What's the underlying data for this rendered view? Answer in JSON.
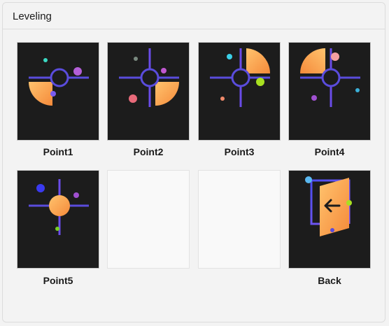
{
  "window": {
    "title": "Leveling"
  },
  "tiles": [
    {
      "label": "Point1",
      "icon": "bed-point-front-left-icon"
    },
    {
      "label": "Point2",
      "icon": "bed-point-front-right-icon"
    },
    {
      "label": "Point3",
      "icon": "bed-point-back-right-icon"
    },
    {
      "label": "Point4",
      "icon": "bed-point-back-left-icon"
    },
    {
      "label": "Point5",
      "icon": "bed-point-center-icon"
    },
    {
      "label": "Back",
      "icon": "exit-door-icon"
    }
  ],
  "colors": {
    "tile_bg": "#1c1c1c",
    "crosshair": "#5a4cdc",
    "accent_orange": "#f7a54a",
    "accent_light": "#ffc36e"
  }
}
